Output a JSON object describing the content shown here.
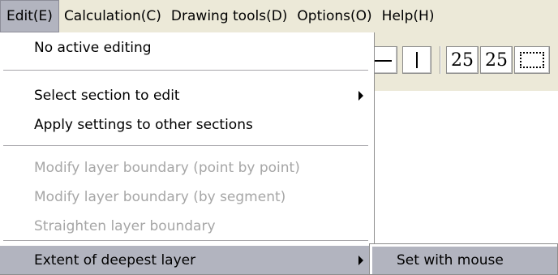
{
  "menubar": {
    "items": [
      {
        "label": "Edit(E)",
        "active": true
      },
      {
        "label": "Calculation(C)",
        "active": false
      },
      {
        "label": "Drawing tools(D)",
        "active": false
      },
      {
        "label": "Options(O)",
        "active": false
      },
      {
        "label": "Help(H)",
        "active": false
      }
    ]
  },
  "toolbar": {
    "font_size_a": "25",
    "font_size_b": "25",
    "icons": [
      "horizontal-line-icon",
      "vertical-line-icon",
      "dotted-rectangle-icon"
    ]
  },
  "edit_menu": {
    "items": [
      {
        "label": "No active editing",
        "enabled": true
      },
      {
        "label": "Select section to edit",
        "enabled": true,
        "has_submenu": true
      },
      {
        "label": "Apply settings to other sections",
        "enabled": true
      },
      {
        "label": "Modify layer boundary (point by point)",
        "enabled": false
      },
      {
        "label": "Modify layer boundary (by segment)",
        "enabled": false
      },
      {
        "label": "Straighten layer boundary",
        "enabled": false
      },
      {
        "label": "Extent of deepest layer",
        "enabled": true,
        "has_submenu": true,
        "highlighted": true
      }
    ]
  },
  "submenu": {
    "items": [
      {
        "label": "Set with mouse",
        "highlighted": true
      }
    ]
  },
  "colors": {
    "menubar_bg": "#ece9d8",
    "highlight": "#b2b4bf",
    "disabled_text": "#a6a6a6"
  }
}
